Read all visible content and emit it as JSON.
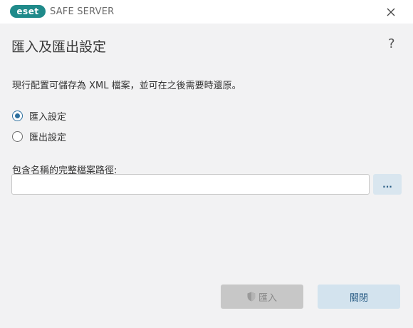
{
  "window": {
    "logo_text": "eset",
    "app_title": "SAFE SERVER",
    "close_icon": "close-icon"
  },
  "dialog": {
    "title": "匯入及匯出設定",
    "help_label": "?",
    "description": "現行配置可儲存為 XML 檔案，並可在之後需要時還原。",
    "options": [
      {
        "label": "匯入設定",
        "selected": true
      },
      {
        "label": "匯出設定",
        "selected": false
      }
    ],
    "path_label": "包含名稱的完整檔案路徑:",
    "path_value": "",
    "browse_label": "...",
    "import_label": "匯入",
    "close_label": "關閉"
  },
  "colors": {
    "accent": "#2b6f9e",
    "logo": "#1f8a8a",
    "background": "#f2f2f3"
  }
}
